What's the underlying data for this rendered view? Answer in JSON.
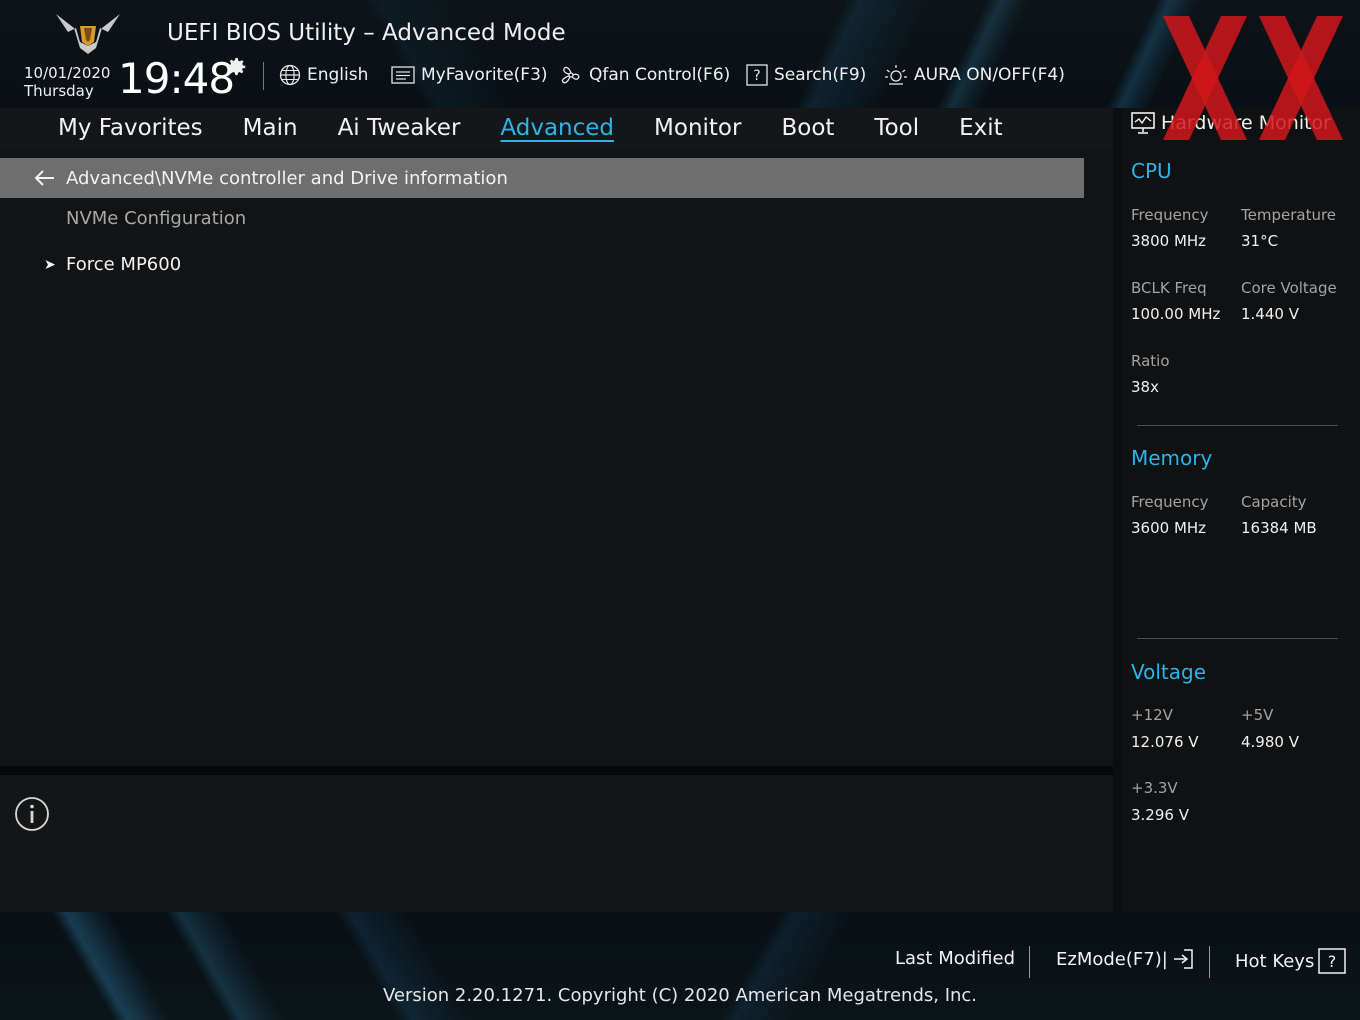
{
  "header": {
    "title": "UEFI BIOS Utility – Advanced Mode",
    "date": "10/01/2020",
    "day": "Thursday",
    "time": "19:48",
    "tools": {
      "language": "English",
      "favorite": "MyFavorite(F3)",
      "qfan": "Qfan Control(F6)",
      "search": "Search(F9)",
      "aura": "AURA ON/OFF(F4)"
    }
  },
  "menu": {
    "tabs": [
      "My Favorites",
      "Main",
      "Ai Tweaker",
      "Advanced",
      "Monitor",
      "Boot",
      "Tool",
      "Exit"
    ],
    "active": "Advanced"
  },
  "main": {
    "breadcrumb": "Advanced\\NVMe controller and Drive information",
    "section_label": "NVMe Configuration",
    "items": [
      {
        "label": "Force MP600"
      }
    ]
  },
  "hardware_monitor": {
    "title": "Hardware Monitor",
    "cpu": {
      "heading": "CPU",
      "frequency_label": "Frequency",
      "frequency": "3800 MHz",
      "temperature_label": "Temperature",
      "temperature": "31°C",
      "bclk_label": "BCLK Freq",
      "bclk": "100.00 MHz",
      "core_voltage_label": "Core Voltage",
      "core_voltage": "1.440 V",
      "ratio_label": "Ratio",
      "ratio": "38x"
    },
    "memory": {
      "heading": "Memory",
      "frequency_label": "Frequency",
      "frequency": "3600 MHz",
      "capacity_label": "Capacity",
      "capacity": "16384 MB"
    },
    "voltage": {
      "heading": "Voltage",
      "v12_label": "+12V",
      "v12": "12.076 V",
      "v5_label": "+5V",
      "v5": "4.980 V",
      "v33_label": "+3.3V",
      "v33": "3.296 V"
    }
  },
  "footer": {
    "last_modified": "Last Modified",
    "ezmode": "EzMode(F7)|",
    "hotkeys": "Hot Keys",
    "version": "Version 2.20.1271. Copyright (C) 2020 American Megatrends, Inc."
  },
  "colors": {
    "accent": "#2bb4e6",
    "breadcrumb_bg": "#6e6e6e",
    "watermark": "#d0161b"
  }
}
